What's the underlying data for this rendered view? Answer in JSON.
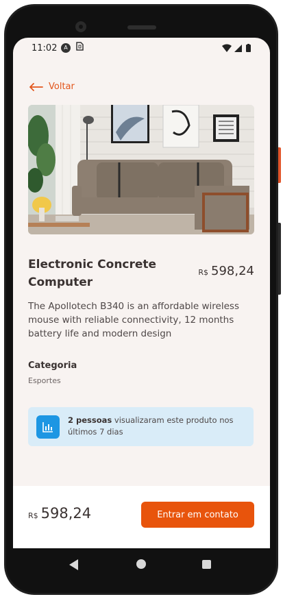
{
  "status_bar": {
    "time": "11:02",
    "icon_a": "A"
  },
  "header": {
    "back_label": "Voltar"
  },
  "product": {
    "title": "Electronic Concrete Computer",
    "currency": "R$",
    "price": "598,24",
    "description": "The Apollotech B340 is an affordable wireless mouse with reliable connectivity, 12 months battery life and modern design",
    "category_heading": "Categoria",
    "category": "Esportes"
  },
  "views": {
    "count_text": "2 pessoas",
    "message": " visualizaram este produto nos últimos 7 dias"
  },
  "footer": {
    "currency": "R$",
    "price": "598,24",
    "contact_label": "Entrar em contato"
  },
  "colors": {
    "accent": "#e8540c",
    "info_bg": "#d9ecf8",
    "info_icon": "#1d96e3",
    "screen_bg": "#f8f3f1"
  }
}
